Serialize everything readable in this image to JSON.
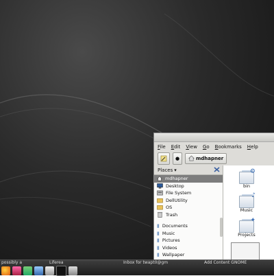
{
  "file_manager": {
    "menu": [
      "File",
      "Edit",
      "View",
      "Go",
      "Bookmarks",
      "Help"
    ],
    "path_button": "mdhapner",
    "places_header": "Places",
    "places": [
      {
        "label": "mdhapner",
        "icon": "home-icon",
        "selected": true
      },
      {
        "label": "Desktop",
        "icon": "desktop-icon"
      },
      {
        "label": "File System",
        "icon": "drive-icon"
      },
      {
        "label": "DellUtility",
        "icon": "folder-icon"
      },
      {
        "label": "OS",
        "icon": "folder-icon"
      },
      {
        "label": "Trash",
        "icon": "trash-icon"
      },
      {
        "label": "Documents",
        "icon": "bookmark-folder-icon"
      },
      {
        "label": "Music",
        "icon": "bookmark-folder-icon"
      },
      {
        "label": "Pictures",
        "icon": "bookmark-folder-icon"
      },
      {
        "label": "Videos",
        "icon": "bookmark-folder-icon"
      },
      {
        "label": "Wallpaper",
        "icon": "bookmark-folder-icon"
      }
    ],
    "files": [
      {
        "label": "bin",
        "emblem": "gear"
      },
      {
        "label": "Music",
        "emblem": "note"
      },
      {
        "label": "Projects",
        "emblem": "sparkle"
      },
      {
        "label": "",
        "emblem": "thumbnail"
      }
    ]
  },
  "panel": {
    "tasks": [
      "possibly a",
      "Liferea",
      "Inbox for twapt0@gm",
      "Add Content GNOME"
    ],
    "launchers": [
      "firefox-icon",
      "music-player-icon",
      "chat-icon",
      "graphics-icon",
      "notes-icon",
      "terminal-icon",
      "editor-icon"
    ]
  },
  "colors": {
    "desktop": "#2a2a2a",
    "selection": "#7d7d7d",
    "panel": "#2b2b2b"
  }
}
